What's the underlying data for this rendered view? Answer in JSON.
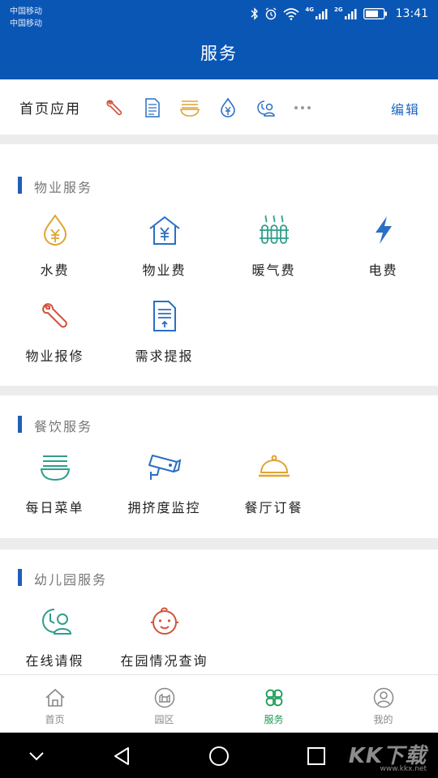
{
  "status_bar": {
    "carrier_1": "中国移动",
    "carrier_2": "中国移动",
    "network_1": "4G",
    "network_2": "2G",
    "time": "13:41"
  },
  "header": {
    "title": "服务"
  },
  "home_apps": {
    "label": "首页应用",
    "edit_label": "编辑",
    "icons": [
      "wrench-icon",
      "document-icon",
      "noodle-bowl-icon",
      "water-yen-icon",
      "leave-person-icon",
      "more-icon"
    ]
  },
  "property": {
    "title": "物业服务",
    "items": [
      {
        "label": "水费",
        "icon": "water-yen-icon"
      },
      {
        "label": "物业费",
        "icon": "house-yen-icon"
      },
      {
        "label": "暖气费",
        "icon": "radiator-icon"
      },
      {
        "label": "电费",
        "icon": "lightning-icon"
      },
      {
        "label": "物业报修",
        "icon": "wrench-icon"
      },
      {
        "label": "需求提报",
        "icon": "document-icon"
      }
    ]
  },
  "dining": {
    "title": "餐饮服务",
    "items": [
      {
        "label": "每日菜单",
        "icon": "noodle-bowl-icon"
      },
      {
        "label": "拥挤度监控",
        "icon": "camera-icon"
      },
      {
        "label": "餐厅订餐",
        "icon": "dish-cloche-icon"
      }
    ]
  },
  "kindergarten": {
    "title": "幼儿园服务",
    "items": [
      {
        "label": "在线请假",
        "icon": "leave-person-icon"
      },
      {
        "label": "在园情况查询",
        "icon": "baby-face-icon"
      }
    ]
  },
  "bottom_nav": {
    "items": [
      {
        "label": "首页",
        "icon": "home-icon"
      },
      {
        "label": "园区",
        "icon": "park-icon"
      },
      {
        "label": "服务",
        "icon": "grid-icon",
        "active": true
      },
      {
        "label": "我的",
        "icon": "profile-icon"
      }
    ]
  },
  "watermark": {
    "logo": "KK下载",
    "url": "www.kkx.net"
  },
  "colors": {
    "brand_blue": "#0a56b5",
    "orange": "#e0a431",
    "teal": "#2f9e8a",
    "red": "#d4523e",
    "blue": "#2a6fc4",
    "active_green": "#1b9a55"
  }
}
